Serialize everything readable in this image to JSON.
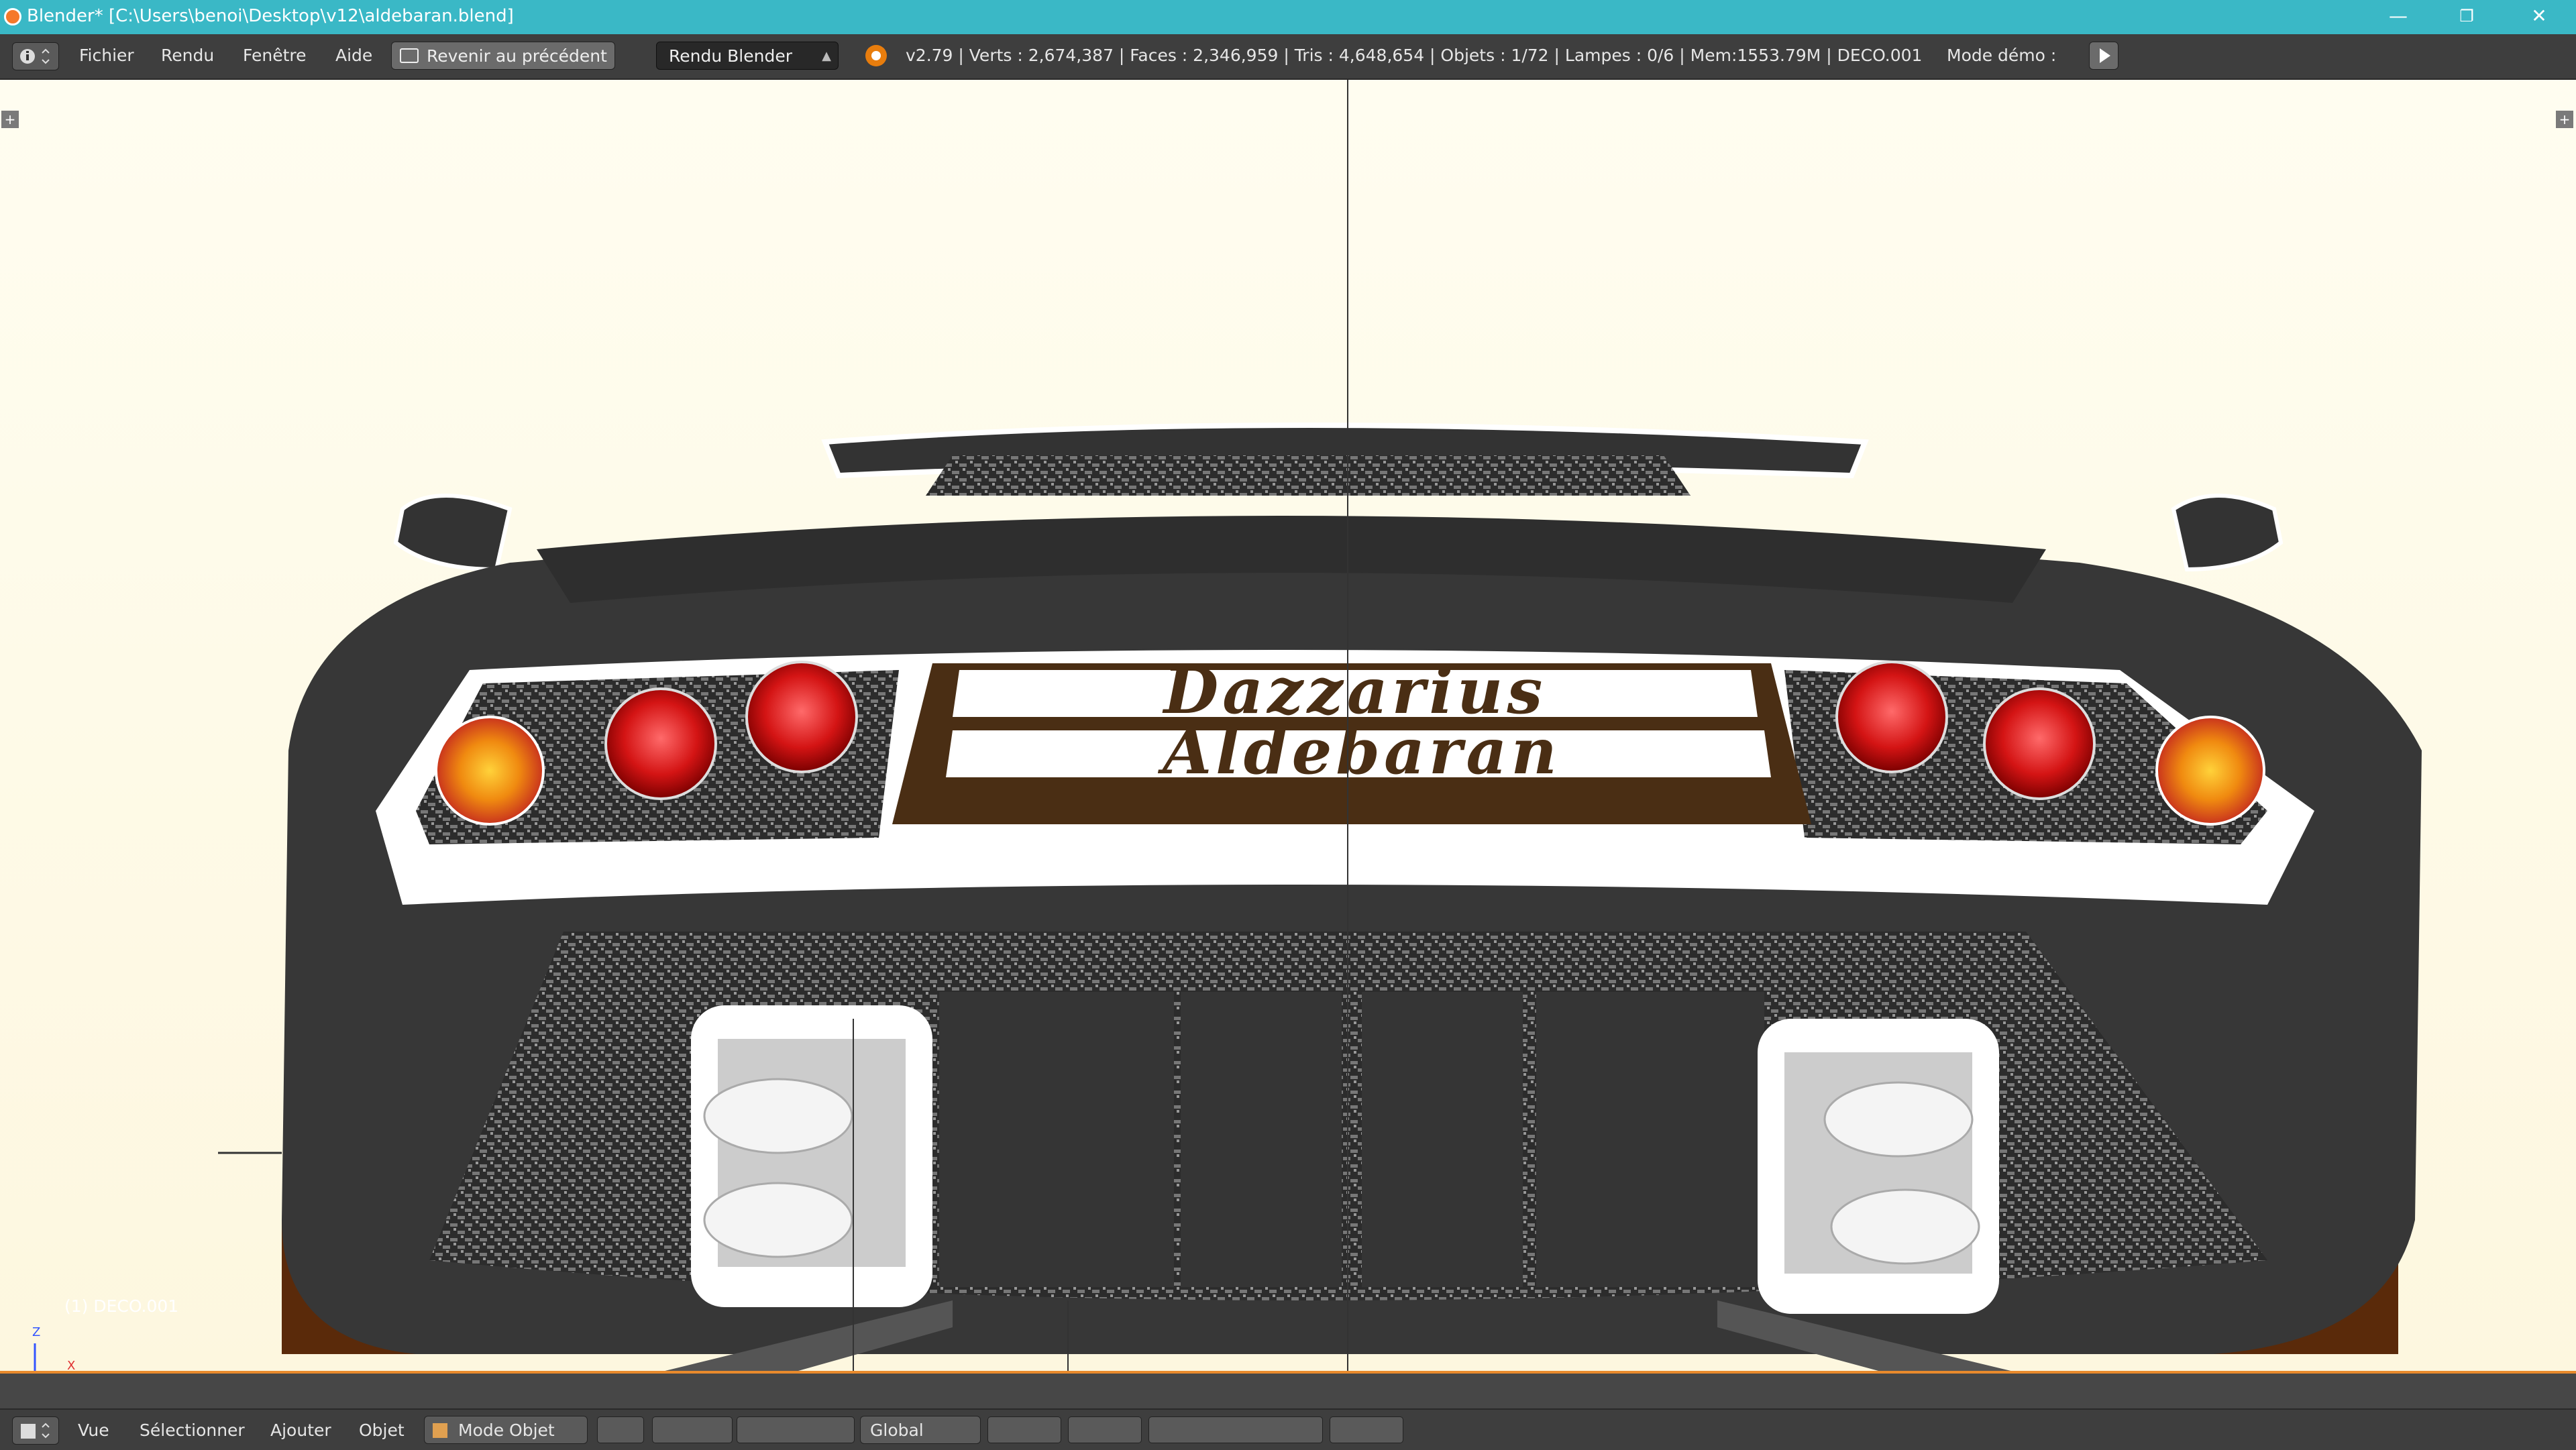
{
  "window": {
    "title": "Blender* [C:\\Users\\benoi\\Desktop\\v12\\aldebaran.blend]",
    "minimize": "—",
    "restore": "❐",
    "close": "✕"
  },
  "infobar": {
    "menus": [
      "Fichier",
      "Rendu",
      "Fenêtre",
      "Aide"
    ],
    "back_label": "Revenir au précédent",
    "render_engine": "Rendu Blender",
    "stats": "v2.79 | Verts   : 2,674,387 | Faces   : 2,346,959 | Tris   : 4,648,654 | Objets   : 1/72 | Lampes   : 0/6 | Mem:1553.79M | DECO.001",
    "demo_mode": "Mode démo  :"
  },
  "viewport": {
    "object_label": "(1) DECO.001",
    "axis_z": "Z",
    "axis_x": "X",
    "plate_line1": "Dazzarius",
    "plate_line2": "Aldebaran"
  },
  "bottombar": {
    "menus": [
      "Vue",
      "Sélectionner",
      "Ajouter",
      "Objet"
    ],
    "mode": "Mode Objet",
    "orientation": "Global"
  },
  "colors": {
    "titlebar": "#3ab8c6",
    "header": "#3e3e3e",
    "viewport_bg": "#fffce8",
    "timeline_line": "#e88a2c"
  }
}
